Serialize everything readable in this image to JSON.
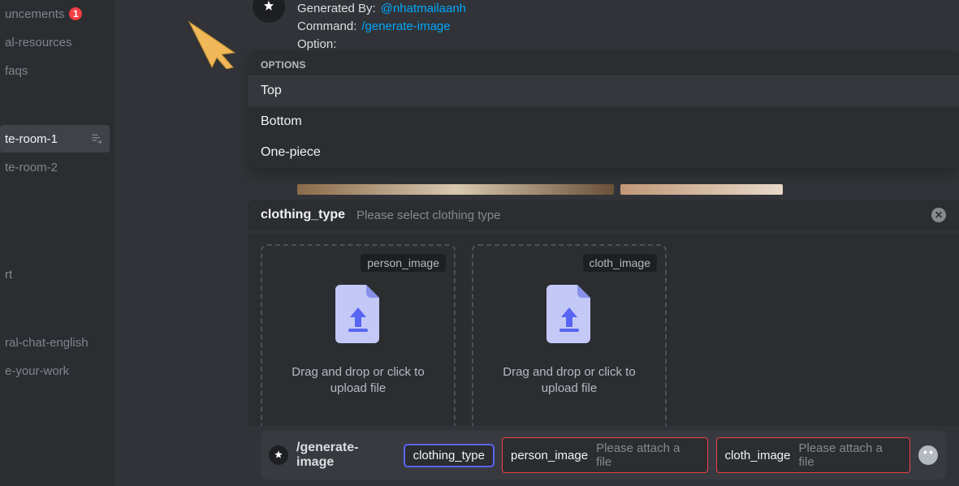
{
  "sidebar": {
    "items": [
      {
        "label": "uncements",
        "badge": "1"
      },
      {
        "label": "al-resources"
      },
      {
        "label": "faqs"
      },
      {
        "label": "te-room-1",
        "active": true,
        "has_thread": true
      },
      {
        "label": "te-room-2"
      },
      {
        "label": ""
      },
      {
        "label": "rt"
      },
      {
        "label": "ral-chat-english"
      },
      {
        "label": "e-your-work"
      }
    ]
  },
  "message": {
    "gen_label": "Generated By:",
    "gen_user": "@nhatmailaanh",
    "cmd_label": "Command:",
    "cmd_value": "/generate-image",
    "opt_label": "Option:"
  },
  "options": {
    "header": "OPTIONS",
    "items": [
      "Top",
      "Bottom",
      "One-piece"
    ],
    "selected_index": 0
  },
  "param": {
    "name": "clothing_type",
    "hint": "Please select clothing type"
  },
  "uploads": [
    {
      "tag": "person_image",
      "hint": "Drag and drop or click to upload file"
    },
    {
      "tag": "cloth_image",
      "hint": "Drag and drop or click to upload file"
    }
  ],
  "footer": {
    "command": "/generate-image",
    "chips": [
      {
        "key": "clothing_type",
        "value": "",
        "state": "active"
      },
      {
        "key": "person_image",
        "value": "Please attach a file",
        "state": "error"
      },
      {
        "key": "cloth_image",
        "value": "Please attach a file",
        "state": "error"
      }
    ]
  }
}
